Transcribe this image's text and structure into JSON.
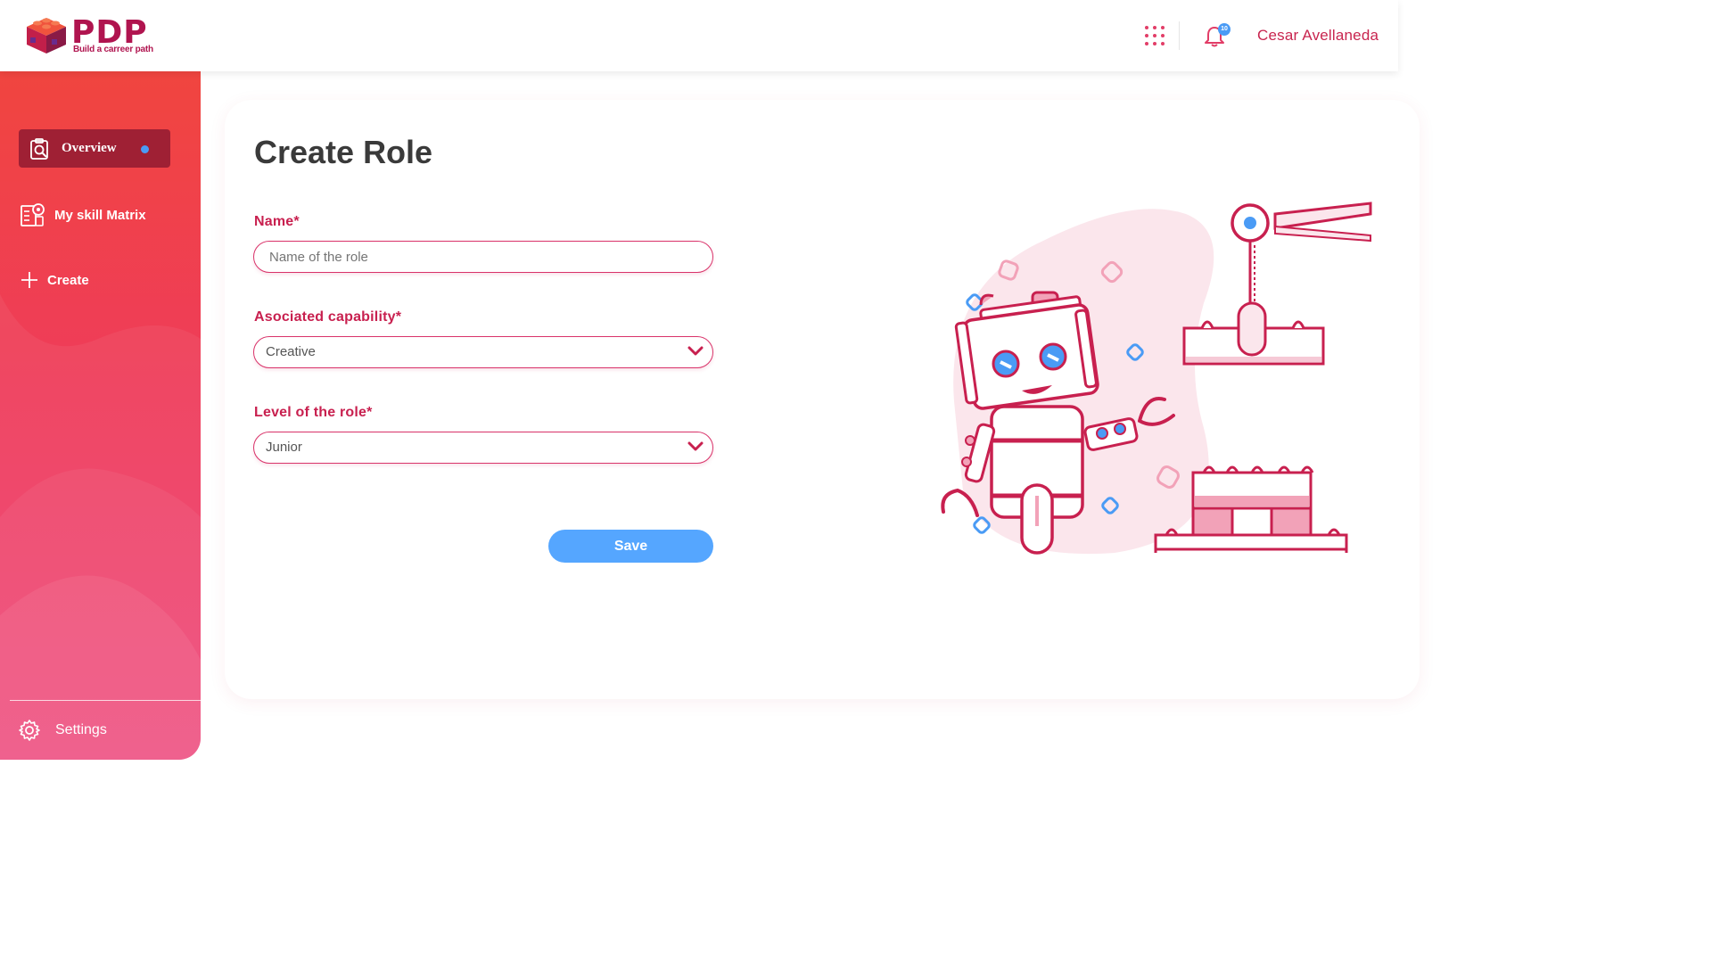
{
  "header": {
    "logo": {
      "text": "PDP",
      "tagline": "Build a carreer path"
    },
    "apps_icon": "grid-dots-icon",
    "notifications": {
      "icon": "bell-icon",
      "count": "10"
    },
    "user_name": "Cesar Avellaneda"
  },
  "sidebar": {
    "items": [
      {
        "label": "Overview",
        "icon": "clipboard-search-icon",
        "active": true
      },
      {
        "label": "My skill Matrix",
        "icon": "skill-matrix-icon"
      },
      {
        "label": "Create",
        "icon": "plus-icon"
      }
    ],
    "settings": {
      "label": "Settings",
      "icon": "gear-icon"
    }
  },
  "form": {
    "title": "Create Role",
    "name": {
      "label": "Name*",
      "placeholder": "Name of the role",
      "value": ""
    },
    "capability": {
      "label": "Asociated capability*",
      "value": "Creative"
    },
    "level": {
      "label": "Level of the role*",
      "value": "Junior"
    },
    "save_label": "Save"
  },
  "colors": {
    "accent": "#c8204f",
    "sidebar_top": "#f0453f",
    "sidebar_bottom": "#ec4077",
    "button": "#55a6ff",
    "badge": "#4a9bf5"
  },
  "illustration": "robot-building-blocks-illustration"
}
